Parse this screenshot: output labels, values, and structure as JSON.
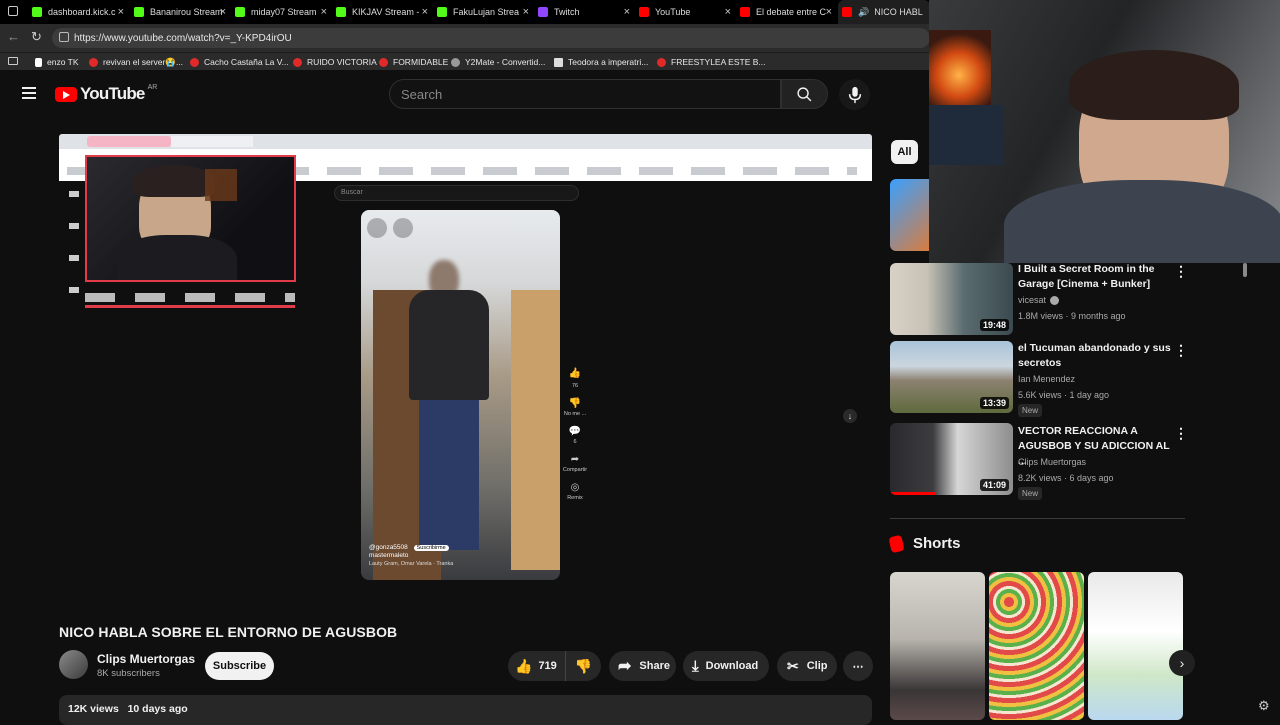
{
  "browser": {
    "tabs": [
      {
        "label": "dashboard.kick.c",
        "color": "#53fc18"
      },
      {
        "label": "Bananirou Stream",
        "color": "#53fc18"
      },
      {
        "label": "miday07 Stream",
        "color": "#53fc18"
      },
      {
        "label": "KIKJAV Stream -",
        "color": "#53fc18"
      },
      {
        "label": "FakuLujan Strea",
        "color": "#53fc18"
      },
      {
        "label": "Twitch",
        "color": "#9146ff"
      },
      {
        "label": "YouTube",
        "color": "#ff0000"
      },
      {
        "label": "El debate entre C",
        "color": "#ff0000"
      },
      {
        "label": "NICO HABL",
        "color": "#ff0000"
      }
    ],
    "url": "https://www.youtube.com/watch?v=_Y-KPD4irOU",
    "bookmarks": [
      "enzo TK",
      "revivan el server😭...",
      "Cacho Castaña La V...",
      "RUIDO VICTORIA",
      "FORMIDABLE",
      "Y2Mate - Convertid...",
      "Teodora a imperatri...",
      "FREESTYLEA ESTE B..."
    ]
  },
  "youtube": {
    "logo_text": "YouTube",
    "region": "AR",
    "search_placeholder": "Search",
    "video": {
      "title": "NICO HABLA SOBRE EL ENTORNO DE AGUSBOB",
      "channel": "Clips Muertorgas",
      "subscribers": "8K subscribers",
      "subscribe_label": "Subscribe",
      "likes": "719",
      "share_label": "Share",
      "download_label": "Download",
      "clip_label": "Clip",
      "views": "12K views",
      "age": "10 days ago"
    },
    "inner_screen": {
      "search_placeholder": "Buscar",
      "reel_user": "@gonza5508",
      "reel_subscribe": "Suscribirme",
      "reel_caption": "mastermaleto",
      "reel_music": "Lauty Gram, Omar Varela · Tranka",
      "like_count": "76",
      "dislike_label": "No me ...",
      "comment_count": "6",
      "share_label": "Compartir",
      "remix_label": "Remix"
    },
    "filter_chip": "All",
    "recommendations": [
      {
        "title": "I Built a Secret Room in the Garage [Cinema + Bunker]",
        "channel": "vicesat",
        "meta": "1.8M views · 9 months ago",
        "duration": "19:48",
        "new": ""
      },
      {
        "title": "el Tucuman abandonado y sus secretos",
        "channel": "Ian Menendez",
        "meta": "5.6K views · 1 day ago",
        "duration": "13:39",
        "new": "New"
      },
      {
        "title": "VECTOR REACCIONA A AGUSBOB Y SU ADICCION AL ...",
        "channel": "Clips Muertorgas",
        "meta": "8.2K views · 6 days ago",
        "duration": "41:09",
        "new": "New"
      }
    ],
    "shorts_label": "Shorts"
  },
  "colors": {
    "accent": "#ff0000",
    "bg": "#0f0f0f",
    "chip": "#272727"
  }
}
